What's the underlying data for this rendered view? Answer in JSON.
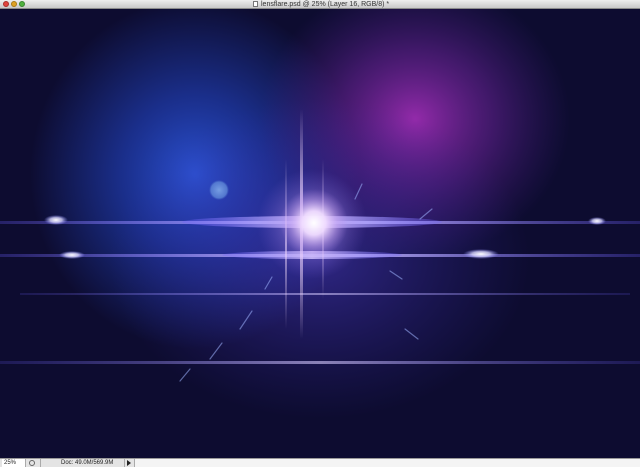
{
  "window": {
    "title": "lensflare.psd @ 25% (Layer 16, RGB/8) *"
  },
  "status_bar": {
    "zoom": "25%",
    "doc_info": "Doc: 49.0M/569.9M"
  },
  "canvas": {
    "background_color": "#0d0c30",
    "glow_colors": [
      "#2345c6",
      "#8a2aa2",
      "#4433b8"
    ],
    "flare_core_color": "#f0dcff",
    "streak_color": "#b4a6ff"
  }
}
